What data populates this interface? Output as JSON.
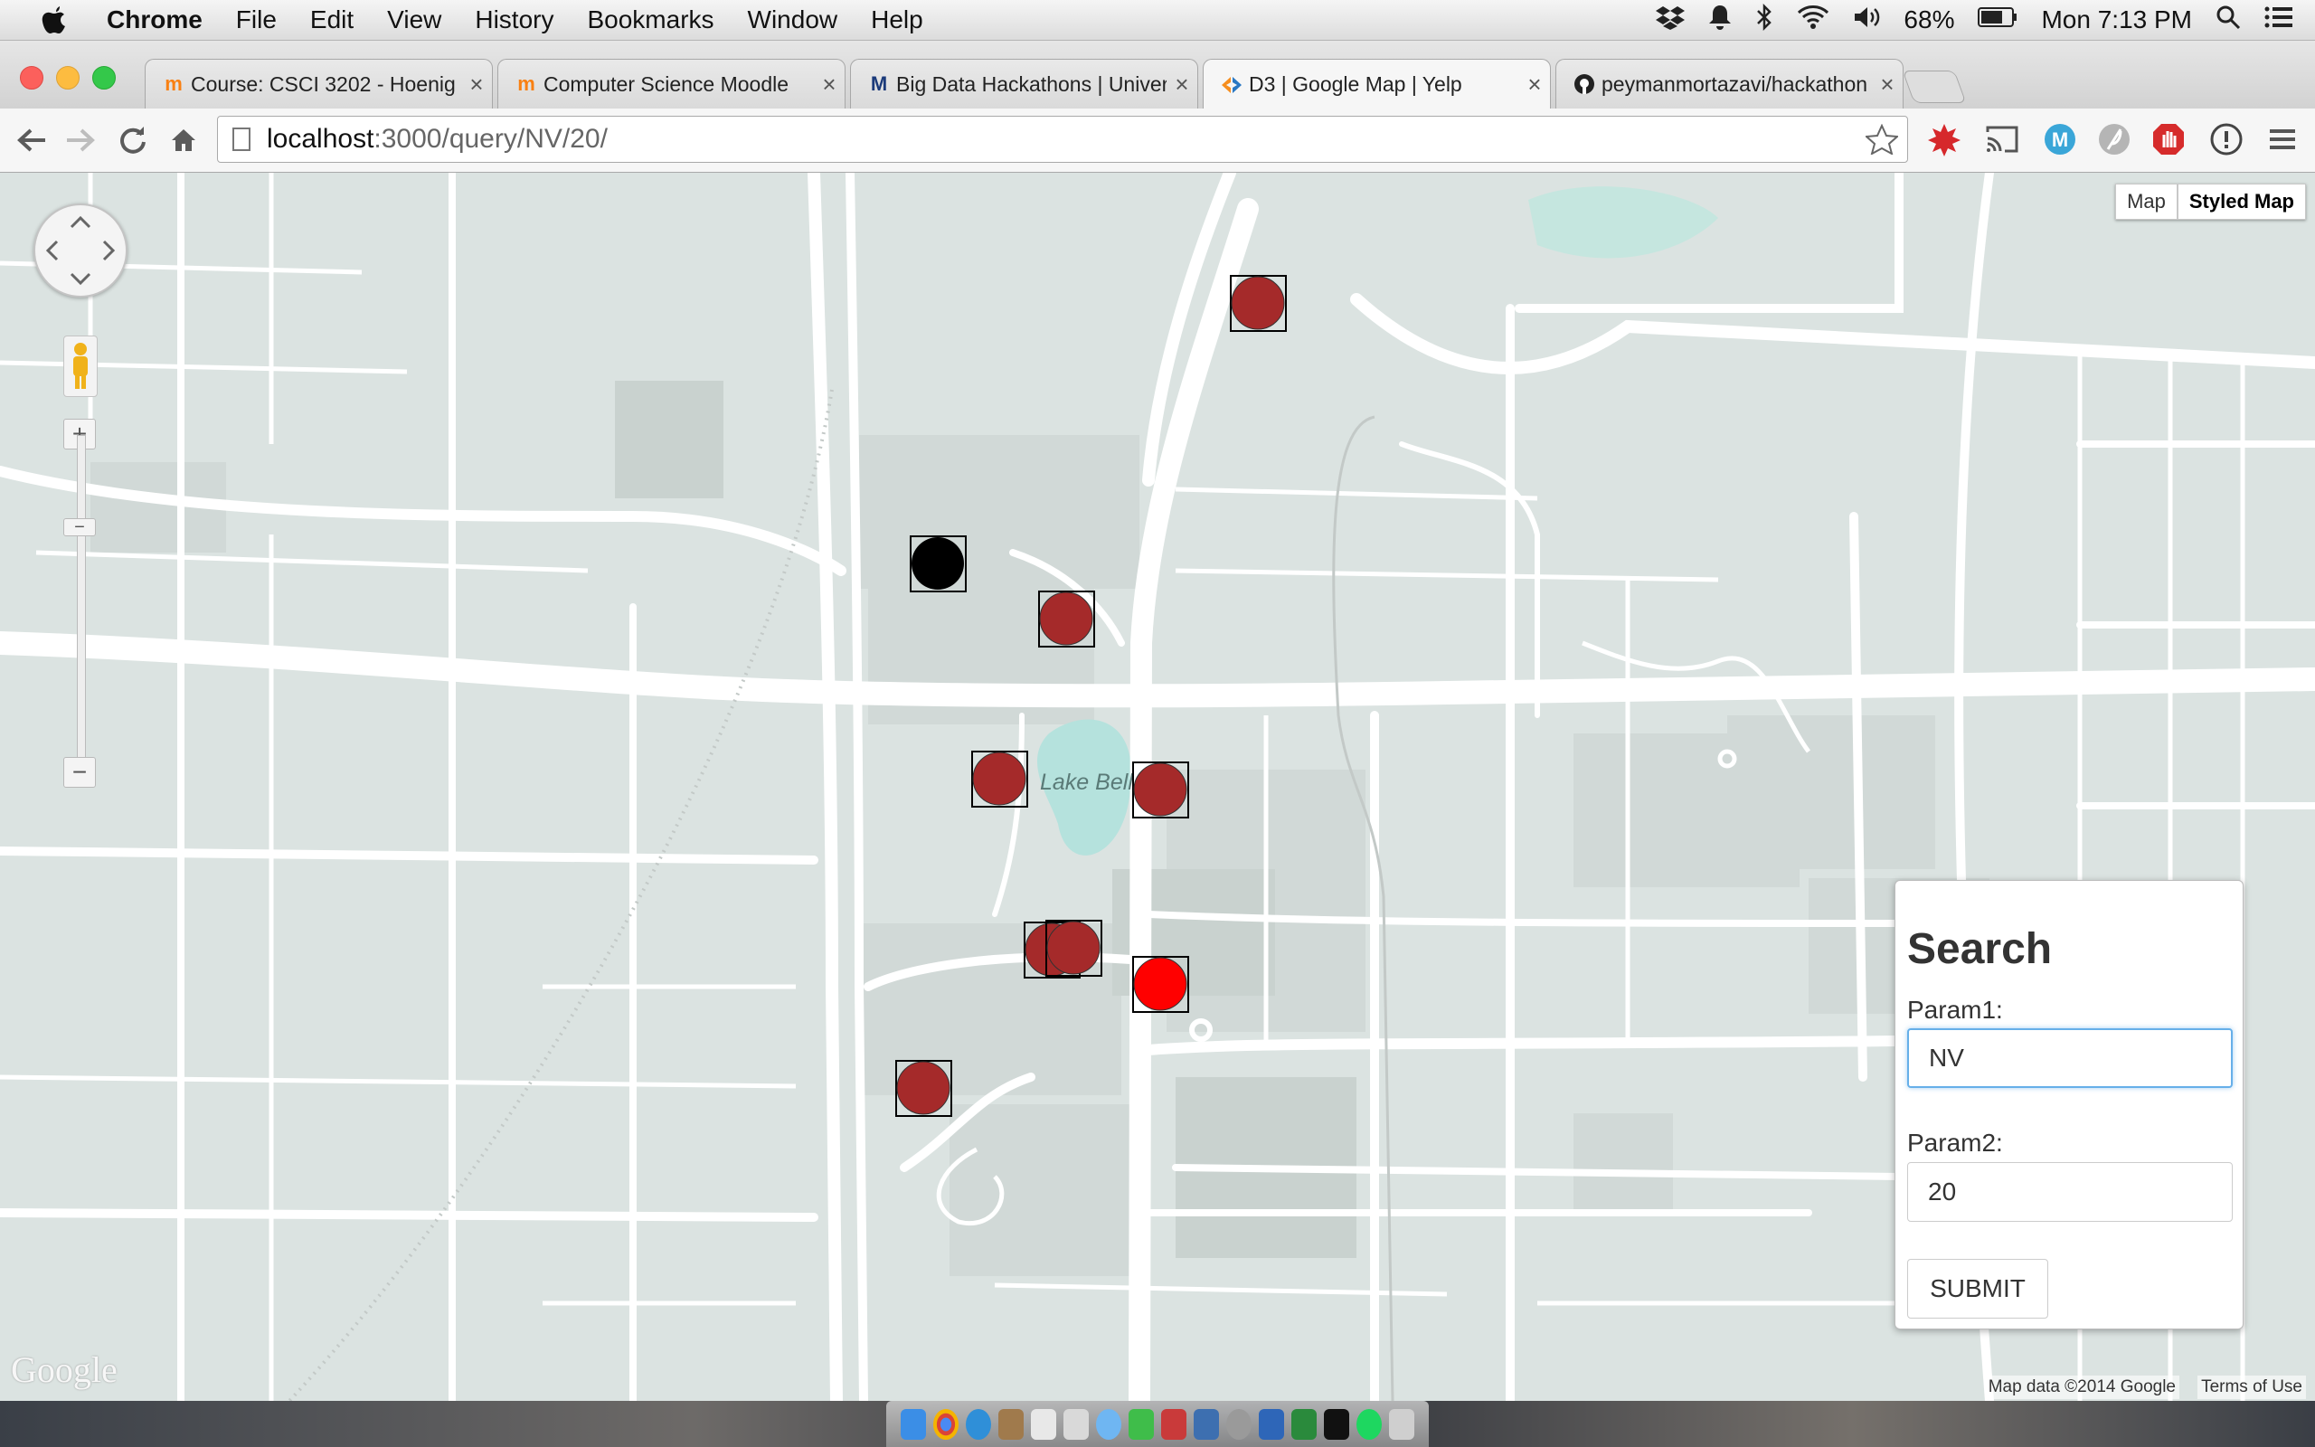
{
  "menubar": {
    "app": "Chrome",
    "menus": [
      "File",
      "Edit",
      "View",
      "History",
      "Bookmarks",
      "Window",
      "Help"
    ],
    "battery": "68%",
    "clock": "Mon 7:13 PM",
    "icons": [
      "dropbox-icon",
      "notification-bell-icon",
      "bluetooth-icon",
      "wifi-icon",
      "volume-icon",
      "battery-icon",
      "spotlight-search-icon",
      "notification-center-icon"
    ]
  },
  "tabs": [
    {
      "title": "Course: CSCI 3202 - Hoenig",
      "favicon": "moodle-icon",
      "active": false
    },
    {
      "title": "Computer Science Moodle",
      "favicon": "moodle-icon",
      "active": false
    },
    {
      "title": "Big Data Hackathons | University",
      "favicon": "m-logo-icon",
      "active": false
    },
    {
      "title": "D3 | Google Map | Yelp",
      "favicon": "d3-icon",
      "active": true
    },
    {
      "title": "peymanmortazavi/hackathon",
      "favicon": "github-icon",
      "active": false
    }
  ],
  "toolbar": {
    "url_host": "localhost",
    "url_path": ":3000/query/NV/20/"
  },
  "map": {
    "type_buttons": [
      "Map",
      "Styled Map"
    ],
    "selected_type": "Styled Map",
    "lake_label": "Lake Bell",
    "attribution": "Map data ©2014 Google",
    "terms": "Terms of Use",
    "logo": "Google",
    "marker_colors": {
      "default": "#a52a2a",
      "black": "#000000",
      "bright": "#ff0000"
    }
  },
  "search": {
    "title": "Search",
    "param1_label": "Param1:",
    "param1_value": "NV",
    "param2_label": "Param2:",
    "param2_value": "20",
    "submit_label": "SUBMIT"
  }
}
